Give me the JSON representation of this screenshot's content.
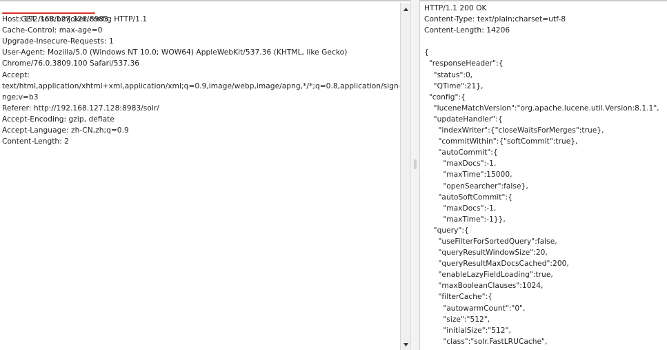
{
  "request": {
    "first_line": "GET /solr/bmjoker/config HTTP/1.1",
    "lines": [
      "Host: 192.168.127.128:8983",
      "Cache-Control: max-age=0",
      "Upgrade-Insecure-Requests: 1",
      "User-Agent: Mozilla/5.0 (Windows NT 10.0; WOW64) AppleWebKit/537.36 (KHTML, like Gecko)",
      "Chrome/76.0.3809.100 Safari/537.36",
      "Accept:",
      "text/html,application/xhtml+xml,application/xml;q=0.9,image/webp,image/apng,*/*;q=0.8,application/signed-excha",
      "nge;v=b3",
      "Referer: http://192.168.127.128:8983/solr/",
      "Accept-Encoding: gzip, deflate",
      "Accept-Language: zh-CN,zh;q=0.9",
      "Content-Length: 2"
    ]
  },
  "response": {
    "lines": [
      "HTTP/1.1 200 OK",
      "Content-Type: text/plain;charset=utf-8",
      "Content-Length: 14206",
      "",
      "{",
      "  \"responseHeader\":{",
      "    \"status\":0,",
      "    \"QTime\":21},",
      "  \"config\":{",
      "    \"luceneMatchVersion\":\"org.apache.lucene.util.Version:8.1.1\",",
      "    \"updateHandler\":{",
      "      \"indexWriter\":{\"closeWaitsForMerges\":true},",
      "      \"commitWithin\":{\"softCommit\":true},",
      "      \"autoCommit\":{",
      "        \"maxDocs\":-1,",
      "        \"maxTime\":15000,",
      "        \"openSearcher\":false},",
      "      \"autoSoftCommit\":{",
      "        \"maxDocs\":-1,",
      "        \"maxTime\":-1}},",
      "    \"query\":{",
      "      \"useFilterForSortedQuery\":false,",
      "      \"queryResultWindowSize\":20,",
      "      \"queryResultMaxDocsCached\":200,",
      "      \"enableLazyFieldLoading\":true,",
      "      \"maxBooleanClauses\":1024,",
      "      \"filterCache\":{",
      "        \"autowarmCount\":\"0\",",
      "        \"size\":\"512\",",
      "        \"initialSize\":\"512\",",
      "        \"class\":\"solr.FastLRUCache\","
    ]
  },
  "icons": {
    "scroll_up": "arrow-up-icon",
    "scroll_down": "arrow-down-icon",
    "splitter_grip": "grip-icon"
  },
  "colors": {
    "underline": "#d93025",
    "text": "#222222",
    "scrollbar_bg": "#f0f0f0"
  }
}
